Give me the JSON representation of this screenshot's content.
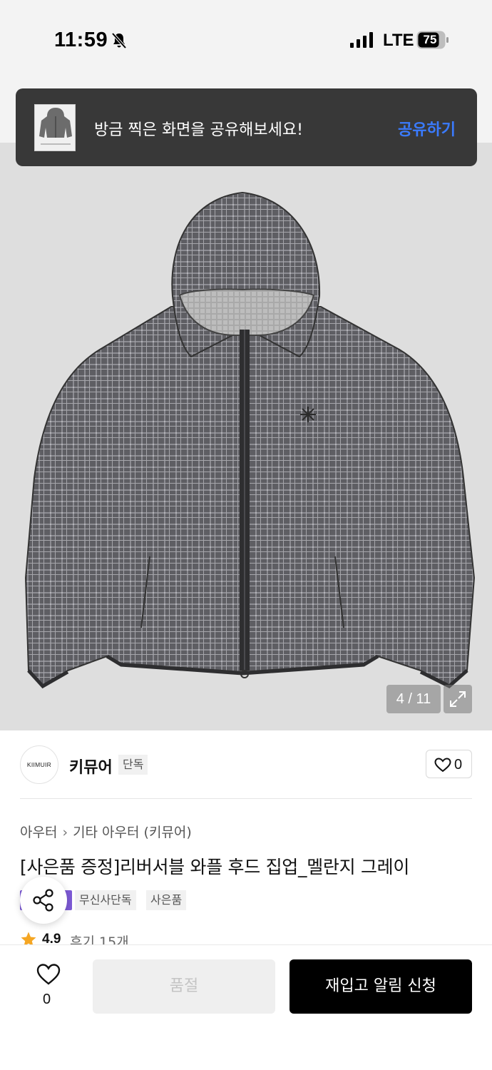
{
  "status_bar": {
    "time": "11:59",
    "network": "LTE",
    "battery": "75",
    "icons": [
      "bell-muted-icon",
      "signal-icon",
      "battery-icon"
    ]
  },
  "toast": {
    "message": "방금 찍은 화면을 공유해보세요!",
    "action": "공유하기",
    "action_color": "#3a7bff"
  },
  "gallery": {
    "counter": "4 / 11",
    "icons": [
      "expand-icon"
    ]
  },
  "brand": {
    "logo_text": "KIIMUIR",
    "name": "키뮤어",
    "badge": "단독",
    "like_count": "0"
  },
  "product": {
    "breadcrumb": [
      "아우터",
      "기타 아우터 (키뮤어)"
    ],
    "title": "[사은품 증정]리버서블 와플 후드 집업_멜란지 그레이",
    "tags": [
      "무신사단독",
      "사은품"
    ],
    "tag_accent_color": "#7d5ad6",
    "rating": "4.9",
    "review_text": "후기 15개"
  },
  "bottom_bar": {
    "wish_count": "0",
    "soldout_label": "품절",
    "restock_label": "재입고 알림 신청"
  },
  "colors": {
    "primary_button": "#000000",
    "disabled_button": "#efefef",
    "star": "#f5a623"
  }
}
